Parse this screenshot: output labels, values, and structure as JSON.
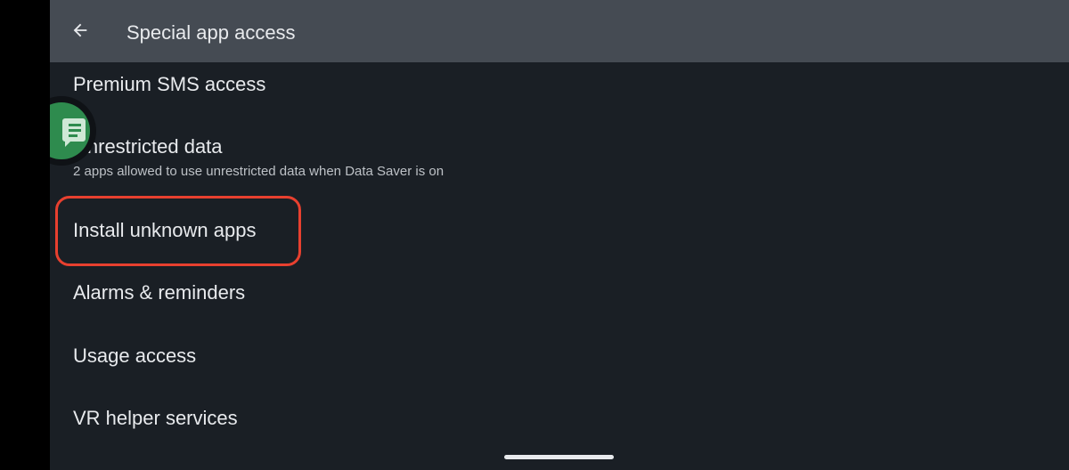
{
  "appbar": {
    "back_icon": "arrow-back-icon",
    "title": "Special app access"
  },
  "items": [
    {
      "title": "Premium SMS access"
    },
    {
      "title": "Unrestricted data",
      "summary": "2 apps allowed to use unrestricted data when Data Saver is on"
    },
    {
      "title": "Install unknown apps",
      "highlighted": true
    },
    {
      "title": "Alarms & reminders"
    },
    {
      "title": "Usage access"
    },
    {
      "title": "VR helper services"
    }
  ],
  "overlay": {
    "chat_bubble_icon": "messages-chat-head-icon",
    "highlight_color": "#e8402f"
  },
  "colors": {
    "appbar": "#454b53",
    "background": "#1a1f25",
    "text_primary": "#e8eaed",
    "text_secondary": "#bdc1c6"
  }
}
